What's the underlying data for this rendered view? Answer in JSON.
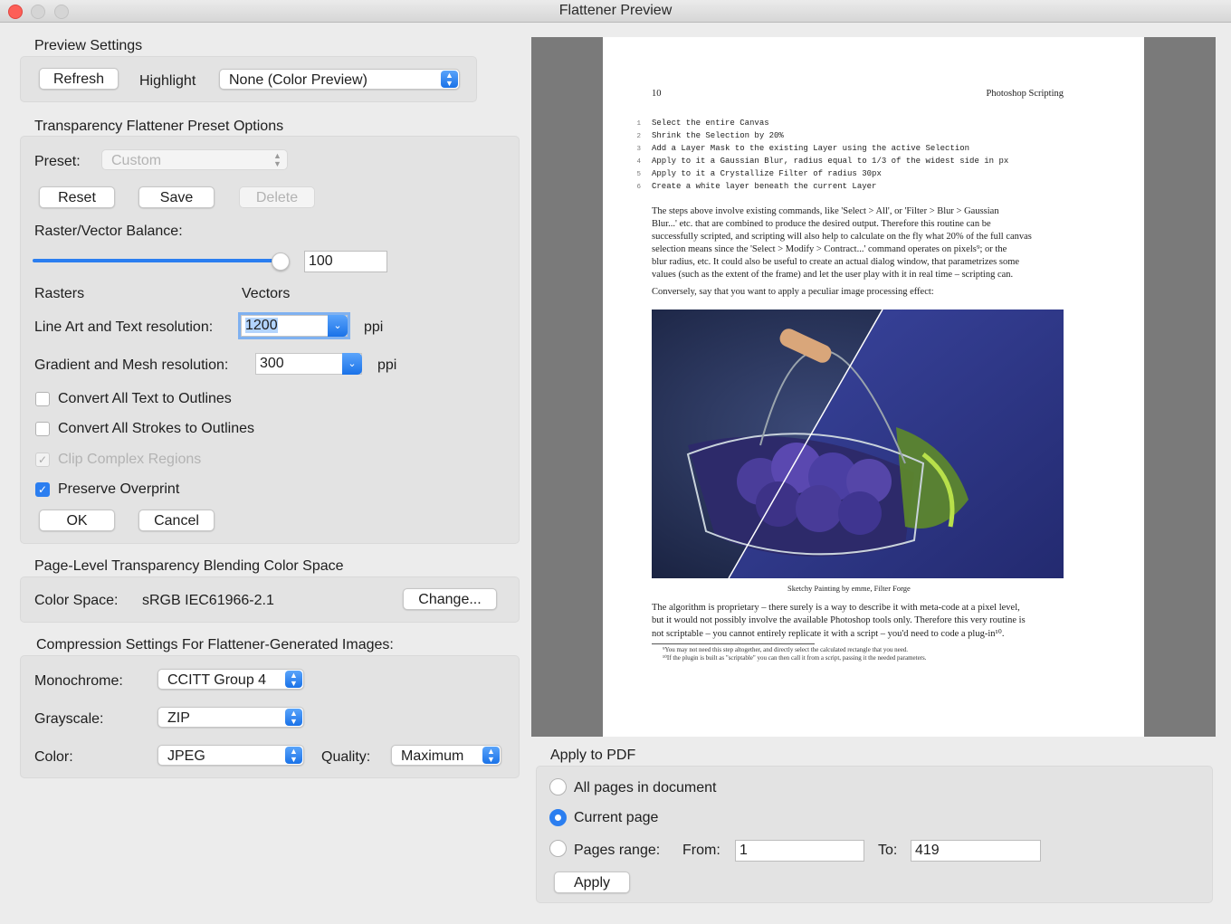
{
  "window": {
    "title": "Flattener Preview"
  },
  "preview_settings": {
    "heading": "Preview Settings",
    "refresh_label": "Refresh",
    "highlight_label": "Highlight",
    "highlight_value": "None (Color Preview)"
  },
  "preset_options": {
    "heading": "Transparency Flattener Preset Options",
    "preset_label": "Preset:",
    "preset_value": "Custom",
    "reset_label": "Reset",
    "save_label": "Save",
    "delete_label": "Delete",
    "balance_label": "Raster/Vector Balance:",
    "balance_value": "100",
    "balance_fraction": 1.0,
    "rasters_label": "Rasters",
    "vectors_label": "Vectors",
    "line_art_label": "Line Art and Text resolution:",
    "line_art_value": "1200",
    "line_art_unit": "ppi",
    "gradient_label": "Gradient and Mesh resolution:",
    "gradient_value": "300",
    "gradient_unit": "ppi",
    "checkboxes": [
      {
        "label": "Convert All Text to Outlines",
        "checked": false,
        "disabled": false
      },
      {
        "label": "Convert All Strokes to Outlines",
        "checked": false,
        "disabled": false
      },
      {
        "label": "Clip Complex Regions",
        "checked": true,
        "disabled": true
      },
      {
        "label": "Preserve Overprint",
        "checked": true,
        "disabled": false
      }
    ],
    "ok_label": "OK",
    "cancel_label": "Cancel"
  },
  "blending": {
    "heading": "Page-Level Transparency Blending Color Space",
    "color_space_label": "Color Space:",
    "color_space_value": "sRGB IEC61966-2.1",
    "change_label": "Change..."
  },
  "compression": {
    "heading": "Compression Settings For Flattener-Generated Images:",
    "monochrome_label": "Monochrome:",
    "monochrome_value": "CCITT Group 4",
    "grayscale_label": "Grayscale:",
    "grayscale_value": "ZIP",
    "color_label": "Color:",
    "color_value": "JPEG",
    "quality_label": "Quality:",
    "quality_value": "Maximum"
  },
  "preview_page": {
    "page_number": "10",
    "running_head": "Photoshop Scripting",
    "code_lines": [
      {
        "n": "1",
        "text": "Select the entire Canvas"
      },
      {
        "n": "2",
        "text": "Shrink the Selection by 20%"
      },
      {
        "n": "3",
        "text": "Add a Layer Mask to the existing Layer using the active Selection"
      },
      {
        "n": "4",
        "text": "Apply to it a Gaussian Blur, radius equal to 1/3 of the widest side in px"
      },
      {
        "n": "5",
        "text": "Apply to it a Crystallize Filter of radius 30px"
      },
      {
        "n": "6",
        "text": "Create a white layer beneath the current Layer"
      }
    ],
    "para1": [
      "The steps above involve existing commands, like 'Select > All', or 'Filter > Blur > Gaussian",
      "Blur...' etc. that are combined to produce the desired output. Therefore this routine can be",
      "successfully scripted, and scripting will also help to calculate on the fly what 20% of the full canvas",
      "selection means since the 'Select > Modify > Contract...' command operates on pixels⁹; or the",
      "blur radius, etc. It could also be useful to create an actual dialog window, that parametrizes some",
      "values (such as the extent of the frame) and let the user play with it in real time – scripting can."
    ],
    "para2": "Conversely, say that you want to apply a peculiar image processing effect:",
    "caption": "Sketchy Painting by emme, Filter Forge",
    "para3": [
      "The algorithm is proprietary – there surely is a way to describe it with meta-code at a pixel level,",
      "but it would not possibly involve the available Photoshop tools only. Therefore this very routine is",
      "not scriptable – you cannot entirely replicate it with a script – you'd need to code a plug-in¹⁰."
    ],
    "footnotes": [
      "⁹You may not need this step altogether, and directly select the calculated rectangle that you need.",
      "¹⁰If the plugin is built as \"scriptable\" you can then call it from a script, passing it the needed parameters."
    ]
  },
  "apply_to_pdf": {
    "heading": "Apply to PDF",
    "all_pages_label": "All pages in document",
    "current_page_label": "Current page",
    "pages_range_label": "Pages range:",
    "from_label": "From:",
    "from_value": "1",
    "to_label": "To:",
    "to_value": "419",
    "apply_label": "Apply",
    "selected": "current_page"
  },
  "colors": {
    "accent": "#2b7ef0",
    "preview_gray": "#7a7a7a"
  }
}
